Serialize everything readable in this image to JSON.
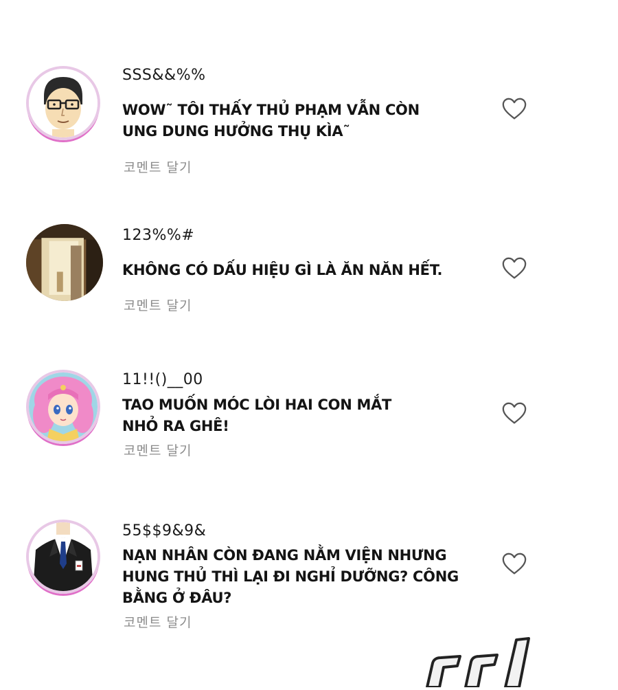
{
  "comments": [
    {
      "username": "SSS&&%%",
      "text_lines": [
        "WOW˜ TÔI THẤY THỦ PHẠM VẪN CÒN",
        "UNG DUNG HƯỞNG THỤ KÌA˜"
      ],
      "reply_label": "코멘트 달기",
      "avatar_icon": "glasses-man-avatar",
      "like_icon": "heart-outline-icon"
    },
    {
      "username": "123%%#",
      "text_lines": [
        "KHÔNG CÓ DẤU HIỆU GÌ LÀ ĂN NĂN HẾT."
      ],
      "reply_label": "코멘트 달기",
      "avatar_icon": "room-photo-avatar",
      "like_icon": "heart-outline-icon"
    },
    {
      "username": "11!!()__00",
      "text_lines": [
        "TAO MUỐN MÓC LÒI HAI CON MẮT",
        "NHỎ RA GHÊ!"
      ],
      "reply_label": "코멘트 달기",
      "avatar_icon": "anime-girl-avatar",
      "like_icon": "heart-outline-icon"
    },
    {
      "username": "55$$9&9&",
      "text_lines": [
        "NẠN NHÂN CÒN ĐANG NẰM VIỆN NHƯNG",
        "HUNG THỦ THÌ LẠI ĐI NGHỈ DƯỠNG? CÔNG",
        "BẰNG Ở ĐÂU?"
      ],
      "reply_label": "코멘트 달기",
      "avatar_icon": "suit-man-avatar",
      "like_icon": "heart-outline-icon"
    }
  ],
  "colors": {
    "avatar_ring": "#e8c8e6",
    "avatar_ring_accent": "#e070c8",
    "reply_text": "#8c8c8c",
    "heart_stroke": "#555555"
  }
}
